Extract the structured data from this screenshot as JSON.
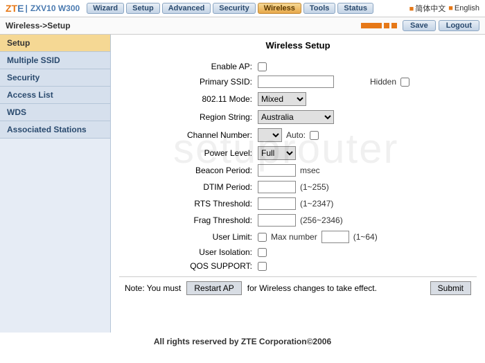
{
  "brand": {
    "zt": "ZT",
    "e": "E",
    "model": "ZXV10 W300"
  },
  "topTabs": [
    "Wizard",
    "Setup",
    "Advanced",
    "Security",
    "Wireless",
    "Tools",
    "Status"
  ],
  "activeTopTab": 4,
  "lang": {
    "cn": "简体中文",
    "en": "English"
  },
  "breadcrumb": "Wireless->Setup",
  "buttons": {
    "save": "Save",
    "logout": "Logout",
    "restart": "Restart AP",
    "submit": "Submit"
  },
  "sidebar": [
    "Setup",
    "Multiple SSID",
    "Security",
    "Access List",
    "WDS",
    "Associated Stations"
  ],
  "activeSidebar": 0,
  "pageTitle": "Wireless Setup",
  "fields": {
    "enableAP": "Enable AP:",
    "primarySSID": "Primary SSID:",
    "hidden": "Hidden",
    "mode": "802.11 Mode:",
    "modeValue": "Mixed",
    "region": "Region String:",
    "regionValue": "Australia",
    "channel": "Channel Number:",
    "channelValue": "",
    "auto": "Auto:",
    "power": "Power Level:",
    "powerValue": "Full",
    "beacon": "Beacon Period:",
    "beaconHint": "msec",
    "dtim": "DTIM Period:",
    "dtimHint": "(1~255)",
    "rts": "RTS Threshold:",
    "rtsHint": "(1~2347)",
    "frag": "Frag Threshold:",
    "fragHint": "(256~2346)",
    "userLimit": "User Limit:",
    "maxNumber": "Max number",
    "maxHint": "(1~64)",
    "isolation": "User Isolation:",
    "qos": "QOS SUPPORT:"
  },
  "note": {
    "pre": "Note: You must",
    "post": "for Wireless changes to take effect."
  },
  "copyright": "All rights reserved by ZTE Corporation©2006",
  "watermark": "setuprouter"
}
